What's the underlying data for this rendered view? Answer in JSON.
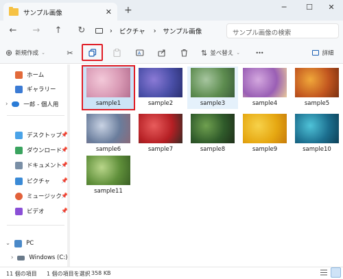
{
  "window": {
    "tab_title": "サンプル画像",
    "new_tab": "+",
    "tab_close": "✕",
    "min": "─",
    "max": "☐",
    "close": "✕"
  },
  "address": {
    "crumbs": [
      "ピクチャ",
      "サンプル画像"
    ],
    "search_placeholder": "サンプル画像の検索"
  },
  "toolbar": {
    "new_label": "新規作成",
    "sort_label": "並べ替え",
    "details_label": "詳細",
    "more": "•••"
  },
  "sidebar": {
    "items": [
      {
        "label": "ホーム",
        "color": "#e26a3a"
      },
      {
        "label": "ギャラリー",
        "color": "#3b7bd4"
      },
      {
        "label": "一郎 - 個人用",
        "color": "#2a7bd6"
      },
      {
        "label": "デスクトップ",
        "color": "#4aa3e8"
      },
      {
        "label": "ダウンロード",
        "color": "#3aa35f"
      },
      {
        "label": "ドキュメント",
        "color": "#7a8fa6"
      },
      {
        "label": "ピクチャ",
        "color": "#3a8ad6"
      },
      {
        "label": "ミュージック",
        "color": "#e2613a"
      },
      {
        "label": "ビデオ",
        "color": "#8a4fd6"
      },
      {
        "label": "PC",
        "color": "#4a89c8"
      },
      {
        "label": "Windows (C:)",
        "color": "#6a7a8a"
      }
    ]
  },
  "files": [
    {
      "name": "sample1",
      "colors": [
        "#d99ab5",
        "#f3c9d9",
        "#b56f90"
      ]
    },
    {
      "name": "sample2",
      "colors": [
        "#4a4fa8",
        "#8b7ad6",
        "#2a2f70"
      ]
    },
    {
      "name": "sample3",
      "colors": [
        "#5d8c4f",
        "#a7c6a0",
        "#3b5d3a"
      ]
    },
    {
      "name": "sample4",
      "colors": [
        "#9a5fb5",
        "#d4a8df",
        "#e8c99a"
      ]
    },
    {
      "name": "sample5",
      "colors": [
        "#c2561f",
        "#f0a83a",
        "#7a2f10"
      ]
    },
    {
      "name": "sample6",
      "colors": [
        "#6a7d9c",
        "#c9d3e4",
        "#8a6a7a"
      ]
    },
    {
      "name": "sample7",
      "colors": [
        "#b51f24",
        "#e85c5c",
        "#3a2a24"
      ]
    },
    {
      "name": "sample8",
      "colors": [
        "#2f5a2a",
        "#6fa04f",
        "#1f2f1a"
      ]
    },
    {
      "name": "sample9",
      "colors": [
        "#e6a812",
        "#f7d24a",
        "#c77b0a"
      ]
    },
    {
      "name": "sample10",
      "colors": [
        "#1c6f8f",
        "#4fc3d8",
        "#0d3f56"
      ]
    },
    {
      "name": "sample11",
      "colors": [
        "#5f8f3a",
        "#b9d68a",
        "#3a5f24"
      ]
    }
  ],
  "status": {
    "count": "11 個の項目",
    "selected": "1 個の項目を選択",
    "size": "358 KB"
  }
}
